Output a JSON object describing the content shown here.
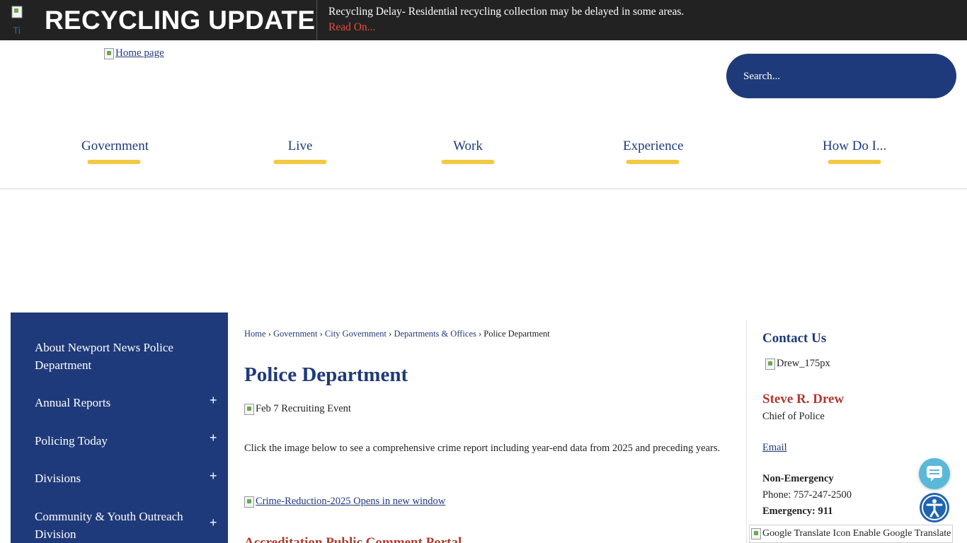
{
  "alert": {
    "title": "RECYCLING UPDATE",
    "icon": "alert-image-icon",
    "message": "Recycling Delay- Residential recycling collection may be delayed in some areas.",
    "link_label": "Read On..."
  },
  "header": {
    "home_alt": "Home page",
    "search_placeholder": "Search..."
  },
  "nav": {
    "items": [
      "Government",
      "Live",
      "Work",
      "Experience",
      "How Do I..."
    ]
  },
  "sidebar": {
    "items": [
      {
        "label": "About Newport News Police Department",
        "expandable": false
      },
      {
        "label": "Annual Reports",
        "expandable": true
      },
      {
        "label": "Policing Today",
        "expandable": true
      },
      {
        "label": "Divisions",
        "expandable": true
      },
      {
        "label": "Community & Youth Outreach Division",
        "expandable": true
      }
    ],
    "expand_symbol": "+"
  },
  "main": {
    "breadcrumb": [
      "Home",
      "Government",
      "City Government",
      "Departments & Offices",
      "Police Department"
    ],
    "breadcrumb_separator": "›",
    "title": "Police Department",
    "event_image_alt": "Feb 7 Recruiting Event",
    "intro": "Click the image below to see a comprehensive crime report including year-end data from 2025 and preceding years.",
    "crime_link_label": "Crime-Reduction-2025 Opens in new window",
    "section_heading": "Accreditation Public Comment Portal"
  },
  "contact": {
    "title": "Contact Us",
    "photo_alt": "Drew_175px",
    "name": "Steve R. Drew",
    "role": "Chief of Police",
    "email_label": "Email",
    "non_emergency_label": "Non-Emergency",
    "phone": "Phone: 757-247-2500",
    "emergency": "Emergency: 911"
  },
  "widgets": {
    "chat_icon": "chat-bubble-icon",
    "accessibility_icon": "accessibility-icon",
    "translate_label": "Google Translate Icon Enable Google Translate"
  },
  "colors": {
    "navy": "#1f3a7a",
    "alert_bg": "#222222",
    "accent_yellow": "#f4c842",
    "accent_red": "#b03a2e"
  }
}
